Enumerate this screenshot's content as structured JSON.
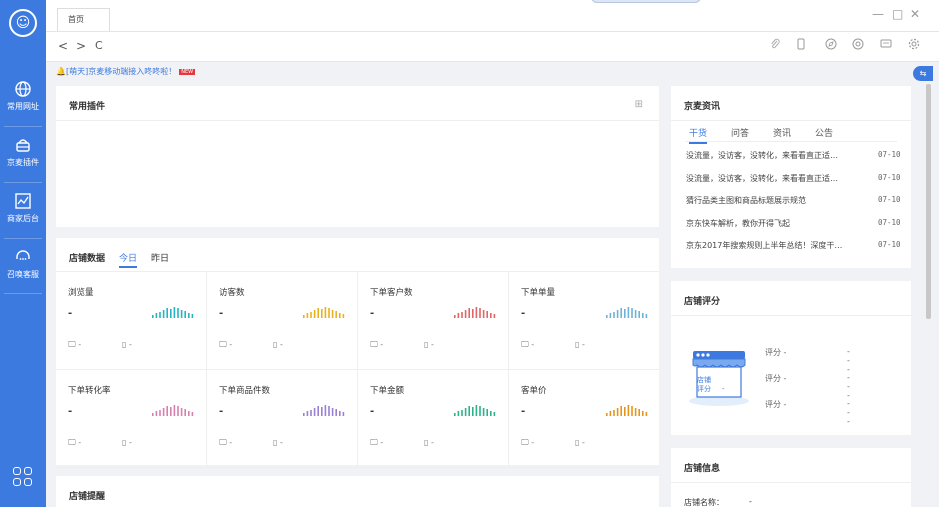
{
  "sidebar": {
    "items": [
      {
        "icon": "globe-icon",
        "label": "常用网址"
      },
      {
        "icon": "basket-icon",
        "label": "京麦插件"
      },
      {
        "icon": "chart-icon",
        "label": "商家后台"
      },
      {
        "icon": "headset-icon",
        "label": "召唤客服"
      }
    ]
  },
  "header": {
    "tab_label": "首页",
    "nav": {
      "back": "<",
      "forward": ">",
      "refresh": "C"
    },
    "window": {
      "minimize": "—",
      "maximize": "□",
      "close": "✕"
    }
  },
  "notice": {
    "text": "[萌天]京麦移动端接入咚咚啦！",
    "hot_label": "NEW"
  },
  "plugins": {
    "title": "常用插件"
  },
  "store_data": {
    "title": "店铺数据",
    "tabs": [
      "今日",
      "昨日"
    ],
    "metrics": [
      {
        "name": "浏览量",
        "value": "-",
        "pc": "-",
        "mobile": "-",
        "color": "#26b3c4"
      },
      {
        "name": "访客数",
        "value": "-",
        "pc": "-",
        "mobile": "-",
        "color": "#e9b21c"
      },
      {
        "name": "下单客户数",
        "value": "-",
        "pc": "-",
        "mobile": "-",
        "color": "#e06666"
      },
      {
        "name": "下单单量",
        "value": "-",
        "pc": "-",
        "mobile": "-",
        "color": "#6fb1d9"
      },
      {
        "name": "下单转化率",
        "value": "-",
        "pc": "-",
        "mobile": "-",
        "color": "#d97fb0"
      },
      {
        "name": "下单商品件数",
        "value": "-",
        "pc": "-",
        "mobile": "-",
        "color": "#9b7fd4"
      },
      {
        "name": "下单金额",
        "value": "-",
        "pc": "-",
        "mobile": "-",
        "color": "#2cb38a"
      },
      {
        "name": "客单价",
        "value": "-",
        "pc": "-",
        "mobile": "-",
        "color": "#e6951c"
      }
    ]
  },
  "reminder": {
    "title": "店铺提醒"
  },
  "news": {
    "title": "京麦资讯",
    "tabs": [
      "干货",
      "问答",
      "资讯",
      "公告"
    ],
    "items": [
      {
        "text": "没流量，没访客，没转化，来看看直正适…",
        "date": "07-10"
      },
      {
        "text": "没流量，没访客，没转化，来看看直正适…",
        "date": "07-10"
      },
      {
        "text": "猜行品类主图和商品标题展示规范",
        "date": "07-10"
      },
      {
        "text": "京东快车解析，教你开得飞起",
        "date": "07-10"
      },
      {
        "text": "京东2017年搜索规则上半年总结！深度干…",
        "date": "07-10"
      }
    ]
  },
  "rating": {
    "title": "店铺评分",
    "badge": "店铺\n评分",
    "badge_value": "-",
    "rows": [
      {
        "label": "评分 -",
        "value": "---"
      },
      {
        "label": "评分 -",
        "value": "---"
      },
      {
        "label": "评分 -",
        "value": "---"
      }
    ]
  },
  "store_info": {
    "title": "店铺信息",
    "name_label": "店铺名称：",
    "name_value": "-"
  }
}
